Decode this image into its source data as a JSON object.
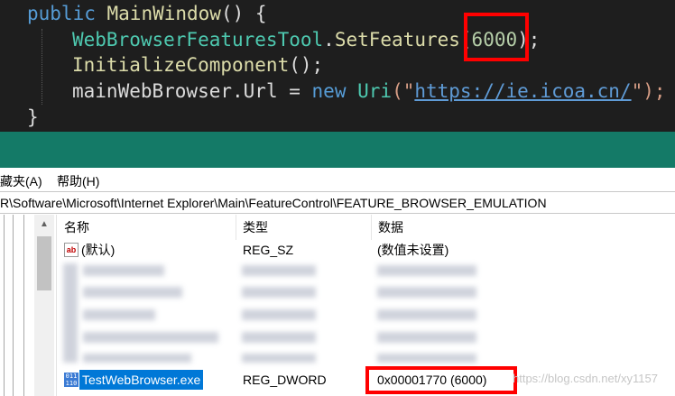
{
  "code": {
    "line1": {
      "kw": "public",
      "name": "MainWindow",
      "rest": "() {"
    },
    "line2": {
      "type": "WebBrowserFeaturesTool",
      "dot": ".",
      "method": "SetFeatures",
      "open": "(",
      "arg": "6000",
      "close": ");"
    },
    "line3": {
      "method": "InitializeComponent",
      "rest": "();"
    },
    "line4": {
      "obj": "mainWebBrowser",
      "prop": ".Url = ",
      "kw": "new",
      "type": "Uri",
      "open": "(\"",
      "url": "https://ie.icoa.cn/",
      "close": "\");"
    },
    "line5": "}"
  },
  "regedit": {
    "menu": [
      "藏夹(A)",
      "帮助(H)"
    ],
    "address": "R\\Software\\Microsoft\\Internet Explorer\\Main\\FeatureControl\\FEATURE_BROWSER_EMULATION",
    "columns": {
      "name": "名称",
      "type": "类型",
      "data": "数据"
    },
    "default_row": {
      "name": "(默认)",
      "type": "REG_SZ",
      "data": "(数值未设置)"
    },
    "selected_row": {
      "name": "TestWebBrowser.exe",
      "type": "REG_DWORD",
      "data": "0x00001770 (6000)"
    },
    "scroll_up": "▲",
    "icons": {
      "default_icon": "ab",
      "dword_icon": "011 110"
    }
  },
  "watermark": "https://blog.csdn.net/xy1157",
  "colors": {
    "highlight": "#ff0000",
    "band": "#147a67",
    "selection": "#0078d7"
  }
}
